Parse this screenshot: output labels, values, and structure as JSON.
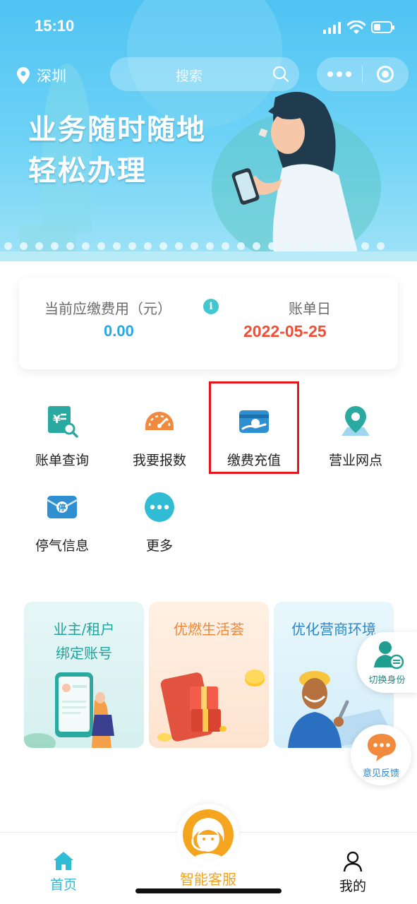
{
  "status_bar": {
    "time": "15:10"
  },
  "header": {
    "location": "深圳",
    "search_placeholder": "搜索",
    "slogan_line1": "业务随时随地",
    "slogan_line2": "轻松办理"
  },
  "fee_card": {
    "current_fee_label": "当前应缴费用（元）",
    "current_fee_value": "0.00",
    "bill_day_label": "账单日",
    "bill_day_value": "2022-05-25"
  },
  "services": [
    {
      "label": "账单查询",
      "icon": "bill-search-icon"
    },
    {
      "label": "我要报数",
      "icon": "meter-gauge-icon"
    },
    {
      "label": "缴费充值",
      "icon": "payment-card-icon"
    },
    {
      "label": "营业网点",
      "icon": "map-pin-icon"
    },
    {
      "label": "停气信息",
      "icon": "gas-stop-icon"
    },
    {
      "label": "更多",
      "icon": "more-dots-icon"
    }
  ],
  "promos": [
    {
      "title_line1": "业主/租户",
      "title_line2": "绑定账号"
    },
    {
      "title_line1": "优燃生活荟",
      "title_line2": ""
    },
    {
      "title_line1": "优化营商环境",
      "title_line2": ""
    }
  ],
  "floating": {
    "switch_identity": "切换身份",
    "feedback": "意见反馈"
  },
  "tabbar": {
    "home": "首页",
    "service": "智能客服",
    "me": "我的"
  },
  "colors": {
    "accent_teal": "#2fbcd4",
    "fee_blue": "#23a8e8",
    "date_red": "#f04e37",
    "service_orange": "#f2a31b",
    "highlight_red": "#e8151c"
  }
}
